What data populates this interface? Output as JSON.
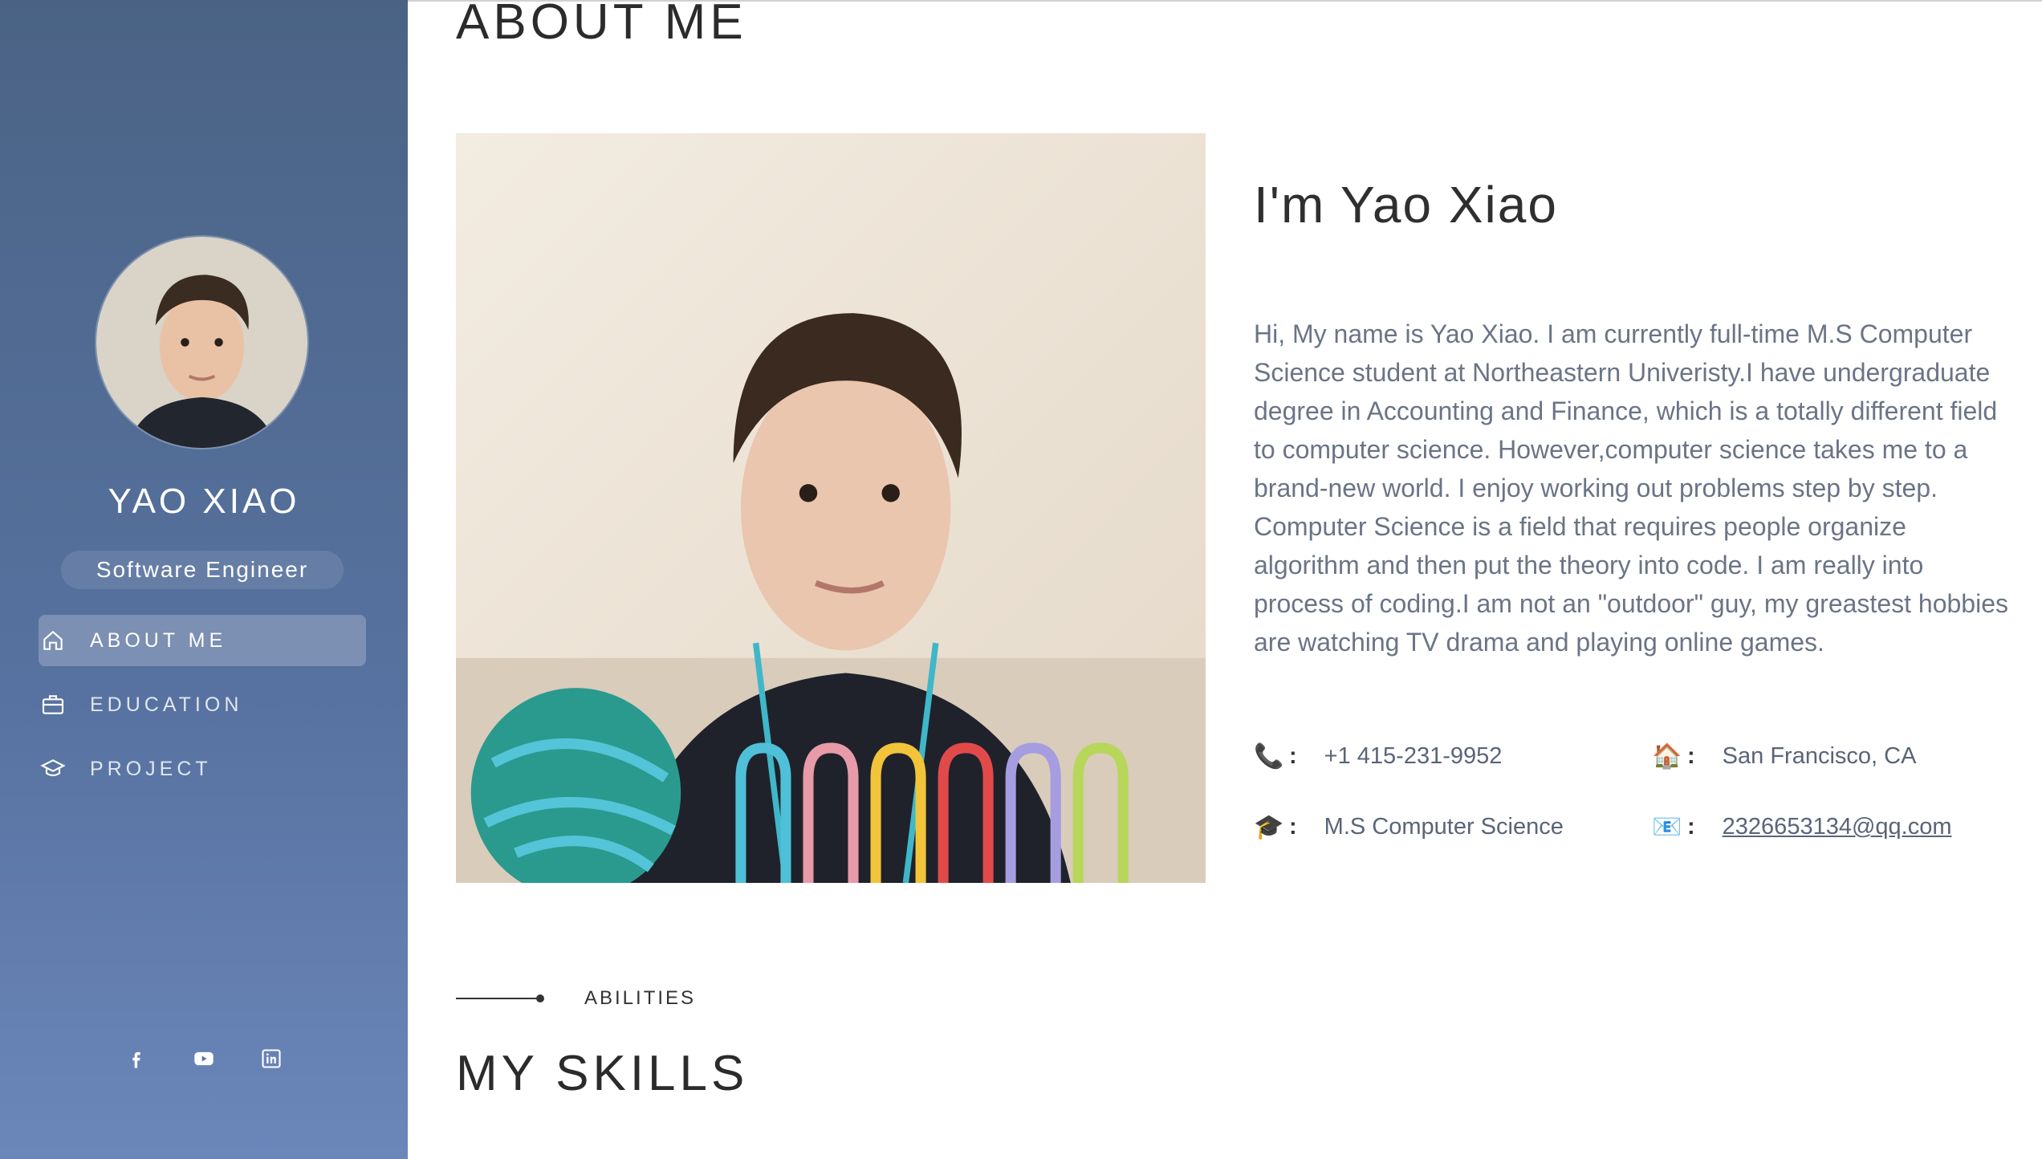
{
  "sidebar": {
    "name": "YAO XIAO",
    "role": "Software Engineer",
    "nav": [
      {
        "label": "ABOUT ME",
        "icon": "home-icon",
        "active": true
      },
      {
        "label": "EDUCATION",
        "icon": "briefcase-icon",
        "active": false
      },
      {
        "label": "PROJECT",
        "icon": "graduation-cap-icon",
        "active": false
      }
    ],
    "social": [
      "facebook-icon",
      "youtube-icon",
      "linkedin-icon"
    ]
  },
  "main": {
    "about_title": "ABOUT ME",
    "greeting": "I'm Yao Xiao",
    "bio": "Hi, My name is Yao Xiao. I am currently full-time M.S Computer Science student at Northeastern Univeristy.I have undergraduate degree in Accounting and Finance, which is a totally different field to computer science. However,computer science takes me to a brand-new world. I enjoy working out problems step by step. Computer Science is a field that requires people organize algorithm and then put the theory into code. I am really into process of coding.I am not an \"outdoor\" guy, my greastest hobbies are watching TV drama and playing online games.",
    "info": {
      "phone": "+1 415-231-9952",
      "location": "San Francisco, CA",
      "education": "M.S Computer Science",
      "email": "2326653134@qq.com"
    },
    "info_icons": {
      "phone": "📞",
      "location": "🏠",
      "education": "🎓",
      "email": "📧",
      "colon": ":"
    },
    "abilities_label": "ABILITIES",
    "skills_title": "MY SKILLS"
  },
  "colors": {
    "sidebar_top": "#4a6385",
    "sidebar_bottom": "#6b87ba",
    "heading": "#2b2b2b",
    "body_text": "#6b7486"
  }
}
